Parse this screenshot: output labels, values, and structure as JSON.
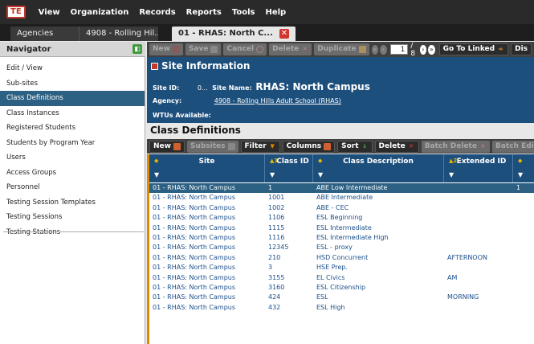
{
  "app": {
    "logo": "TE"
  },
  "menu": [
    "View",
    "Organization",
    "Records",
    "Reports",
    "Tools",
    "Help"
  ],
  "tabs": [
    {
      "label": "Agencies"
    },
    {
      "label": "4908 - Rolling Hil..."
    },
    {
      "label": "01 - RHAS: North C...",
      "close": "✕"
    }
  ],
  "navigator": {
    "title": "Navigator",
    "toggle": "◧",
    "items": [
      "Edit / View",
      "Sub-sites",
      "Class Definitions",
      "Class Instances",
      "Registered Students",
      "Students by Program Year",
      "Users",
      "Access Groups",
      "Personnel",
      "Testing Session Templates",
      "Testing Sessions",
      "Testing Stations"
    ],
    "active_index": 2
  },
  "toolbar": {
    "new": "New",
    "save": "Save",
    "cancel": "Cancel",
    "delete": "Delete",
    "duplicate": "Duplicate",
    "page_value": "1",
    "page_total": "/ 8",
    "go_to_linked": "Go To Linked",
    "dis": "Dis"
  },
  "site_info": {
    "title": "Site Information",
    "site_id_label": "Site ID:",
    "site_id_value": "0...",
    "site_name_label": "Site Name:",
    "site_name_value": "RHAS: North Campus",
    "agency_label": "Agency:",
    "agency_value": "4908 - Rolling Hills Adult School (RHAS)",
    "wtus_label": "WTUs Available:"
  },
  "class_definitions": {
    "title": "Class Definitions",
    "toolbar": {
      "new": "New",
      "subsites": "Subsites",
      "filter": "Filter",
      "columns": "Columns",
      "sort": "Sort",
      "delete": "Delete",
      "batch_delete": "Batch Delete",
      "batch_edit": "Batch Edit"
    },
    "columns": [
      {
        "label": "Site",
        "sort": ""
      },
      {
        "label": "Class ID",
        "sort": "1"
      },
      {
        "label": "Class Description",
        "sort": ""
      },
      {
        "label": "Extended ID",
        "sort": "2"
      },
      {
        "label": "",
        "sort": ""
      }
    ],
    "rows": [
      {
        "site": "01 - RHAS: North Campus",
        "class_id": "1",
        "desc": "ABE Low Intermediate",
        "ext": "",
        "extra": "1"
      },
      {
        "site": "01 - RHAS: North Campus",
        "class_id": "1001",
        "desc": "ABE Intermediate",
        "ext": "",
        "extra": ""
      },
      {
        "site": "01 - RHAS: North Campus",
        "class_id": "1002",
        "desc": "ABE - CEC",
        "ext": "",
        "extra": ""
      },
      {
        "site": "01 - RHAS: North Campus",
        "class_id": "1106",
        "desc": "ESL Beginning",
        "ext": "",
        "extra": ""
      },
      {
        "site": "01 - RHAS: North Campus",
        "class_id": "1115",
        "desc": "ESL Intermediate",
        "ext": "",
        "extra": ""
      },
      {
        "site": "01 - RHAS: North Campus",
        "class_id": "1116",
        "desc": "ESL Intermediate High",
        "ext": "",
        "extra": ""
      },
      {
        "site": "01 - RHAS: North Campus",
        "class_id": "12345",
        "desc": "ESL - proxy",
        "ext": "",
        "extra": ""
      },
      {
        "site": "01 - RHAS: North Campus",
        "class_id": "210",
        "desc": "HSD Concurrent",
        "ext": "AFTERNOON",
        "extra": ""
      },
      {
        "site": "01 - RHAS: North Campus",
        "class_id": "3",
        "desc": "HSE Prep.",
        "ext": "",
        "extra": ""
      },
      {
        "site": "01 - RHAS: North Campus",
        "class_id": "3155",
        "desc": "EL Civics",
        "ext": "AM",
        "extra": ""
      },
      {
        "site": "01 - RHAS: North Campus",
        "class_id": "3160",
        "desc": "ESL Citizenship",
        "ext": "",
        "extra": ""
      },
      {
        "site": "01 - RHAS: North Campus",
        "class_id": "424",
        "desc": "ESL",
        "ext": "MORNING",
        "extra": ""
      },
      {
        "site": "01 - RHAS: North Campus",
        "class_id": "432",
        "desc": "ESL High",
        "ext": "",
        "extra": ""
      }
    ],
    "selected_index": 0
  },
  "colors": {
    "accent_blue": "#1d4f7c",
    "selection": "#2d6183",
    "danger": "#c0392b",
    "success": "#3d9a3d",
    "row_text": "#1a4e8a"
  }
}
